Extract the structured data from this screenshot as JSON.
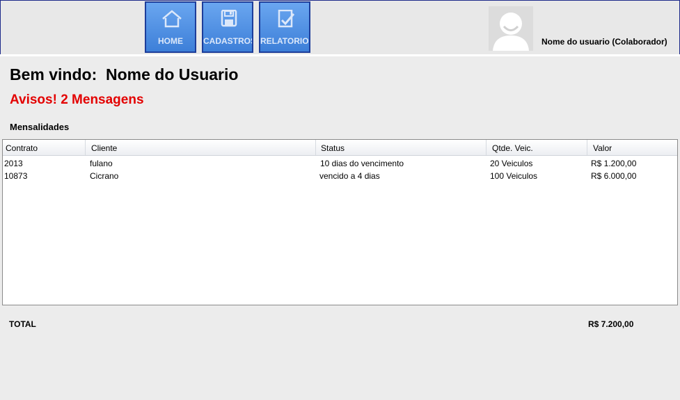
{
  "nav": {
    "items": [
      {
        "label": "HOME",
        "icon": "home-icon"
      },
      {
        "label": "CADASTROS",
        "icon": "save-icon"
      },
      {
        "label": "RELATORIOS",
        "icon": "report-check-icon"
      }
    ]
  },
  "user": {
    "name": "Nome do usuario (Colaborador)",
    "avatar_icon": "user-avatar-icon"
  },
  "welcome": "Bem vindo:  Nome do Usuario",
  "alerts": "Avisos! 2 Mensagens",
  "section_title": "Mensalidades",
  "table": {
    "headers": [
      "Contrato",
      "Cliente",
      "Status",
      "Qtde. Veic.",
      "Valor"
    ],
    "rows": [
      [
        "2013",
        "fulano",
        "10 dias do vencimento",
        "20 Veiculos",
        "R$ 1.200,00"
      ],
      [
        "10873",
        "Cicrano",
        "vencido a 4 dias",
        "100 Veiculos",
        "R$ 6.000,00"
      ]
    ]
  },
  "total": {
    "label": "TOTAL",
    "value": "R$ 7.200,00"
  },
  "colors": {
    "nav_button": "#4a8ce0",
    "nav_border": "#1d3d9a",
    "alert_red": "#e30000",
    "background": "#ececec"
  }
}
